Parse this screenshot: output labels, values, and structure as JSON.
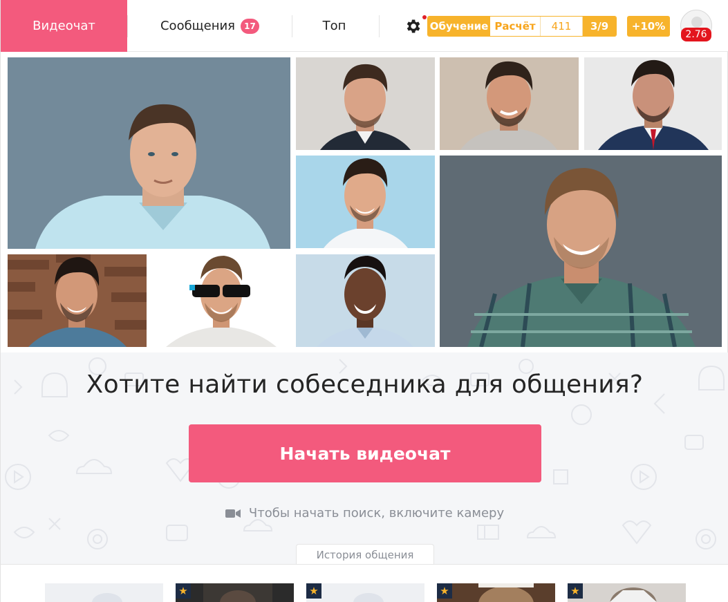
{
  "header": {
    "tabs": {
      "videochat": "Видеочат",
      "messages": "Сообщения",
      "messages_badge": "17",
      "top": "Топ"
    },
    "stats": {
      "training": "Обучение",
      "calculation": "Расчёт",
      "count": "411",
      "level": "3/9",
      "bonus": "+10%"
    },
    "rating": "2.76",
    "icons": {
      "settings": "gear-icon",
      "notification": "notification-dot-icon",
      "avatar": "user-avatar-icon"
    },
    "colors": {
      "accent": "#f35a7d",
      "stats": "#f7b32b",
      "rating": "#e3151d"
    }
  },
  "gallery": {
    "photos": [
      {
        "id": "photo-1",
        "shirt": "#bfe3ee",
        "bg": "#6f8695"
      },
      {
        "id": "photo-2",
        "shirt": "#222a36",
        "bg": "#d9d6d2"
      },
      {
        "id": "photo-3",
        "shirt": "#c5c2be",
        "bg": "#cdbfb0"
      },
      {
        "id": "photo-4",
        "shirt": "#213559",
        "bg": "#e9e9e9"
      },
      {
        "id": "photo-5",
        "shirt": "#f4f6f8",
        "bg": "#a9d6ea"
      },
      {
        "id": "photo-6",
        "shirt": "#4e7a73",
        "bg": "#5f6b74"
      },
      {
        "id": "photo-7",
        "shirt": "#4d7b9b",
        "bg": "#8a5a40"
      },
      {
        "id": "photo-8",
        "shirt": "#e8e7e4",
        "bg": "#ffffff"
      },
      {
        "id": "photo-9",
        "shirt": "#c5d8ea",
        "bg": "#c7dbe8"
      }
    ]
  },
  "hero": {
    "title": "Хотите найти собеседника для общения?",
    "cta": "Начать видеочат",
    "hint": "Чтобы начать поиск, включите камеру",
    "hint_icon": "video-camera-icon",
    "history_tab": "История общения"
  },
  "history": {
    "star_icon": "star-icon",
    "cards": [
      {
        "starred": false,
        "tone": "#eef0f3"
      },
      {
        "starred": true,
        "tone": "#2b2b2b"
      },
      {
        "starred": true,
        "tone": "#eef0f3"
      },
      {
        "starred": true,
        "tone": "#a37f5e"
      },
      {
        "starred": true,
        "tone": "#8a7a6c"
      }
    ]
  }
}
